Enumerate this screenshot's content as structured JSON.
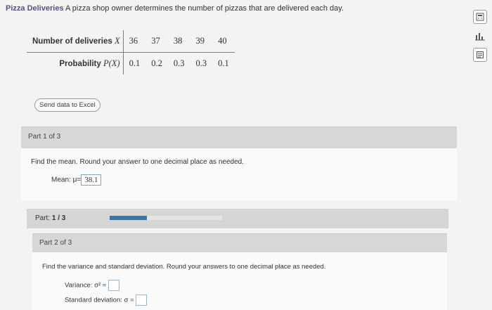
{
  "problem": {
    "title": "Pizza Deliveries",
    "statement": "A pizza shop owner determines the number of pizzas that are delivered each day."
  },
  "toolbar": {
    "icons": [
      "calculator-icon",
      "chart-icon",
      "notes-icon"
    ]
  },
  "table": {
    "row1_label_text": "Number of deliveries",
    "row1_var": "X",
    "row2_label_text": "Probability",
    "row2_var": "P(X)",
    "x_values": [
      "36",
      "37",
      "38",
      "39",
      "40"
    ],
    "p_values": [
      "0.1",
      "0.2",
      "0.3",
      "0.3",
      "0.1"
    ]
  },
  "excel_button": "Send data to Excel",
  "part1": {
    "header": "Part 1 of 3",
    "question": "Find the mean. Round your answer to one decimal place as needed.",
    "mean_label": "Mean:",
    "mean_symbol": "μ=",
    "mean_value": "38.1"
  },
  "progress": {
    "label": "Part:",
    "value": "1 / 3",
    "fraction": 0.333
  },
  "part2": {
    "header": "Part 2 of 3",
    "question": "Find the variance and standard deviation. Round your answers to one decimal place as needed.",
    "variance_label": "Variance:",
    "variance_symbol": "σ² =",
    "stddev_label": "Standard deviation:",
    "stddev_symbol": "σ ="
  }
}
